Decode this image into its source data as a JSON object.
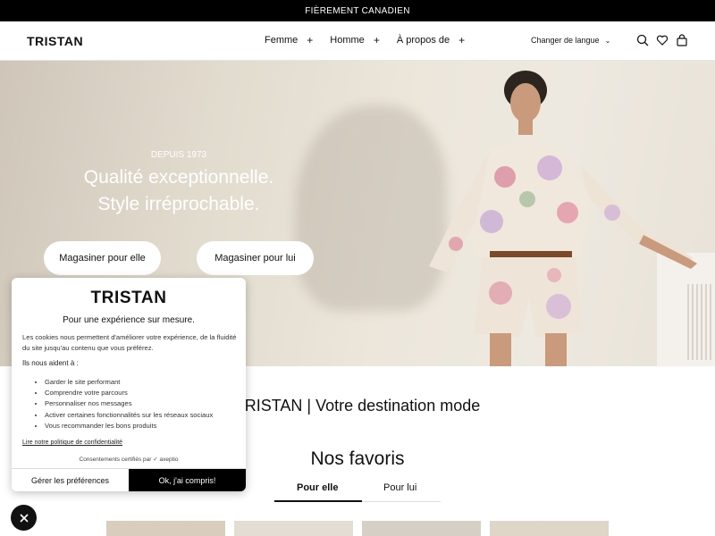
{
  "announcement": "FIÈREMENT CANADIEN",
  "header": {
    "logo": "TRISTAN",
    "nav": [
      {
        "label": "Femme",
        "toggle": "+"
      },
      {
        "label": "Homme",
        "toggle": "+"
      },
      {
        "label": "À propos de",
        "toggle": "+"
      }
    ],
    "language": "Changer de langue",
    "icons": [
      "search-icon",
      "heart-icon",
      "bag-icon"
    ]
  },
  "hero": {
    "subtitle": "DEPUIS 1973",
    "title_line1": "Qualité exceptionnelle.",
    "title_line2": "Style irréprochable.",
    "btn_her": "Magasiner pour elle",
    "btn_him": "Magasiner pour lui"
  },
  "main": {
    "tagline": "TRISTAN | Votre destination mode",
    "favorites_title": "Nos favoris",
    "tabs": [
      "Pour elle",
      "Pour lui"
    ],
    "active_tab": "Pour elle"
  },
  "cookie": {
    "logo": "TRISTAN",
    "title": "Pour une expérience sur mesure.",
    "description": "Les cookies nous permettent d'améliorer votre expérience, de la fluidité du site jusqu'au contenu que vous préférez.",
    "help_heading": "Ils nous aident à :",
    "items": [
      "Garder le site performant",
      "Comprendre votre parcours",
      "Personnaliser nos messages",
      "Activer certaines fonctionnalités sur les réseaux sociaux",
      "Vous recommander les bons produits"
    ],
    "policy_link": "Lire notre politique de confidentialité",
    "certified": "Consentements certifiés par",
    "certifier": "axeptio",
    "btn_manage": "Gérer les préférences",
    "btn_accept": "Ok, j'ai compris!"
  },
  "colors": {
    "topbar": "#000000",
    "accept_button": "#000000",
    "hero_background": "#e8e2d8"
  }
}
